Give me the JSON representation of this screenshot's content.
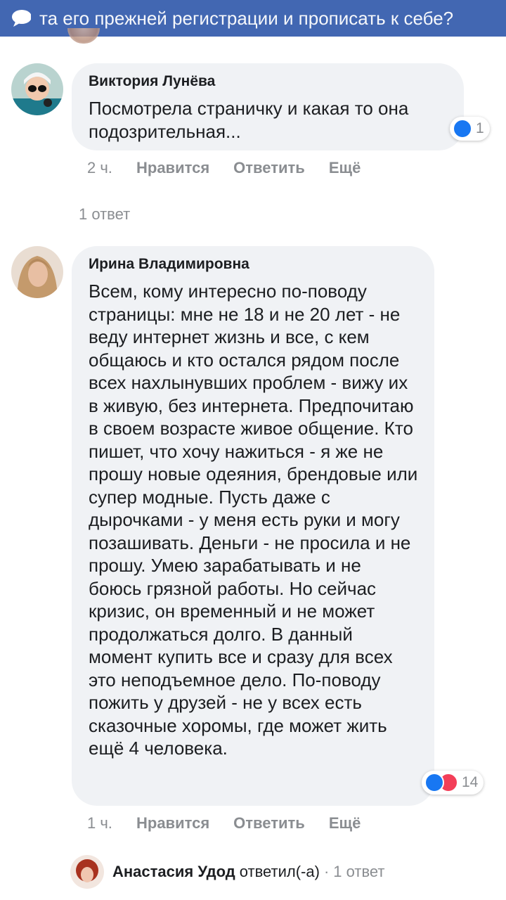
{
  "banner": {
    "text": "та его прежней регистрации и прописать к себе?",
    "bg_color": "#4267b2",
    "icon": "chat-bubble-icon"
  },
  "comments": [
    {
      "author": "Виктория Лунёва",
      "text": "Посмотрела страничку и какая то она подозрительная...",
      "reaction_count": "1",
      "reactions": [
        "like"
      ],
      "time": "2 ч.",
      "like_label": "Нравится",
      "reply_label": "Ответить",
      "more_label": "Ещё",
      "replies_label": "1 ответ"
    },
    {
      "author": "Ирина Владимировна",
      "text": "Всем, кому интересно по-поводу страницы: мне не 18 и не 20 лет - не веду интернет жизнь и все, с кем общаюсь и кто остался рядом после всех нахлынувших проблем - вижу их в живую, без интернета. Предпочитаю в своем возрасте живое общение. Кто пишет, что хочу нажиться - я же не прошу новые одеяния, брендовые или супер модные. Пусть даже с дырочками - у меня есть руки и могу позашивать. Деньги - не просила и не прошу. Умею зарабатывать и не боюсь грязной работы. Но сейчас кризис, он временный и не может продолжаться долго. В данный момент купить все и сразу для всех это неподъемное дело. По-поводу пожить у друзей - не у всех есть сказочные хоромы, где может жить ещё 4 человека.",
      "reaction_count": "14",
      "reactions": [
        "like",
        "love"
      ],
      "time": "1 ч.",
      "like_label": "Нравится",
      "reply_label": "Ответить",
      "more_label": "Ещё"
    }
  ],
  "reply_preview": {
    "name": "Анастасия Удод",
    "verb": "ответил(-а)",
    "separator": "·",
    "count": "1 ответ"
  },
  "colors": {
    "bubble": "#f0f2f5",
    "like": "#1877f2",
    "love": "#f33e58",
    "muted": "#8a8d91"
  }
}
